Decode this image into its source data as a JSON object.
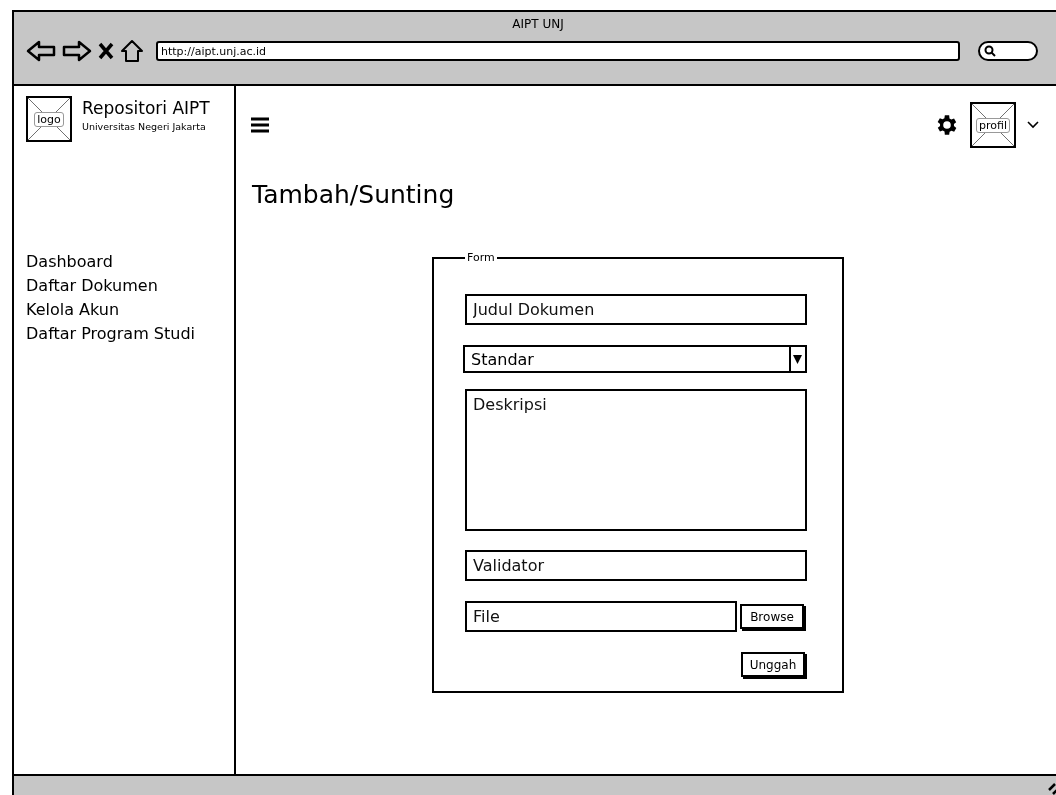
{
  "window": {
    "title": "AIPT UNJ",
    "url": "http://aipt.unj.ac.id"
  },
  "sidebar": {
    "logo_label": "logo",
    "app_name": "Repositori AIPT",
    "subtitle": "Universitas Negeri Jakarta",
    "items": [
      {
        "label": "Dashboard"
      },
      {
        "label": "Daftar Dokumen"
      },
      {
        "label": "Kelola Akun"
      },
      {
        "label": "Daftar Program Studi"
      }
    ]
  },
  "header": {
    "profile_label": "profil"
  },
  "page": {
    "title": "Tambah/Sunting"
  },
  "form": {
    "legend": "Form",
    "fields": [
      {
        "kind": "text",
        "placeholder": "Judul Dokumen"
      },
      {
        "kind": "select",
        "value": "Standar"
      },
      {
        "kind": "textarea",
        "placeholder": "Deskripsi"
      },
      {
        "kind": "text",
        "placeholder": "Validator"
      },
      {
        "kind": "file",
        "placeholder": "File",
        "button": "Browse"
      }
    ],
    "submit": "Unggah"
  }
}
